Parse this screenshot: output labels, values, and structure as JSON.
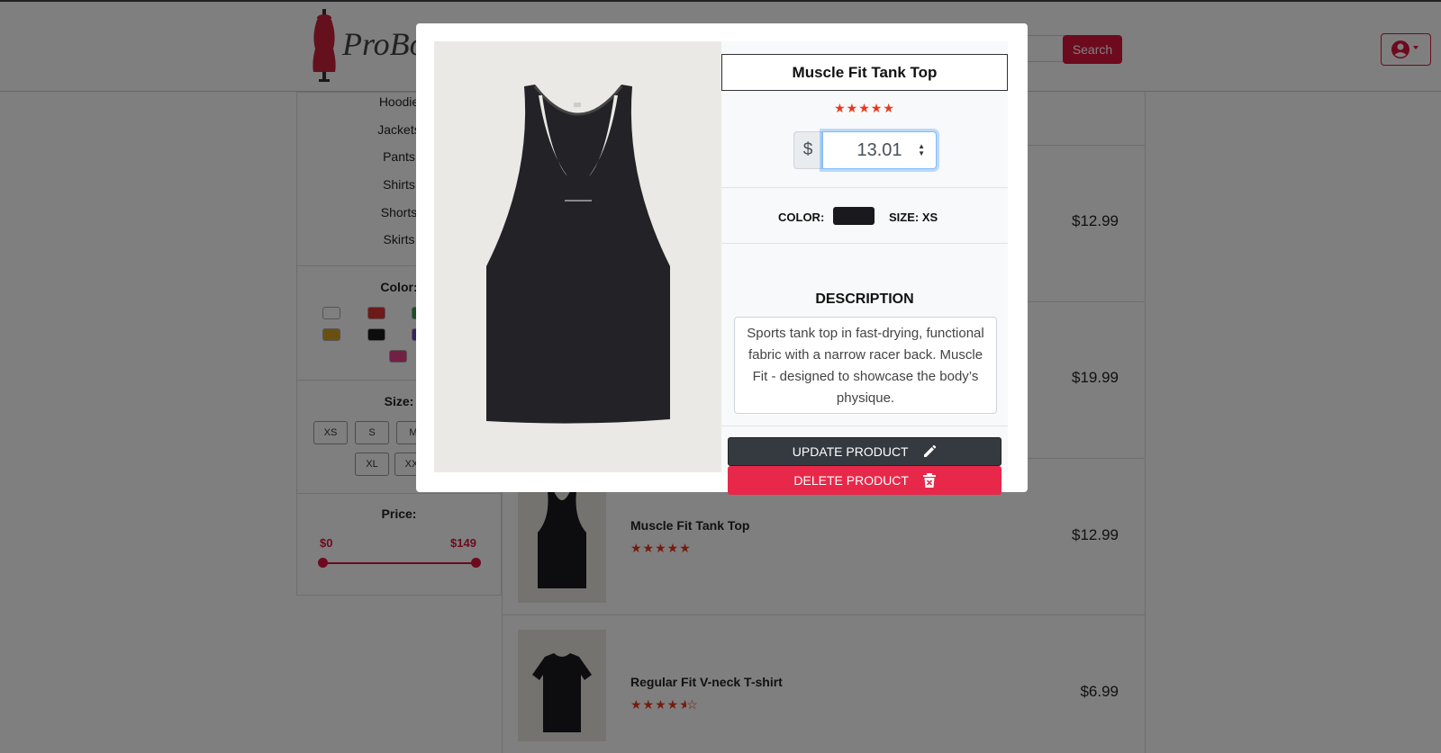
{
  "header": {
    "brand": "ProBo",
    "search_button": "Search"
  },
  "sidebar": {
    "categories": [
      "Hoodie",
      "Jackets",
      "Pants",
      "Shirts",
      "Shorts",
      "Skirts"
    ],
    "color_heading": "Color:",
    "colors": [
      "#ffffff",
      "#dc3535",
      "#28a745",
      "#d4a020",
      "#1a1a1a",
      "#6f42c1",
      "#e83e8c"
    ],
    "size_heading": "Size:",
    "sizes": [
      "XS",
      "S",
      "M",
      "XL",
      "XX"
    ],
    "price_heading": "Price:",
    "price_min": "$0",
    "price_max": "$149"
  },
  "products": [
    {
      "name": "",
      "price": "$12.99"
    },
    {
      "name": "",
      "price": "$19.99"
    },
    {
      "name": "Muscle Fit Tank Top",
      "price": "$12.99",
      "rating": 5
    },
    {
      "name": "Regular Fit V-neck T-shirt",
      "price": "$6.99",
      "rating": 4.5
    }
  ],
  "modal": {
    "title": "Muscle Fit Tank Top",
    "rating": 5,
    "currency": "$",
    "price": "13.01",
    "color_label": "COLOR:",
    "color_value": "#1a1a1e",
    "size_label": "SIZE: XS",
    "description_heading": "DESCRIPTION",
    "description": "Sports tank top in fast-drying, functional fabric with a narrow racer back. Muscle Fit - designed to showcase the body’s physique.",
    "update_label": "UPDATE PRODUCT",
    "delete_label": "DELETE PRODUCT"
  },
  "colors": {
    "accent": "#dc143c",
    "star": "#e8391e",
    "dark_button": "#343a40"
  }
}
